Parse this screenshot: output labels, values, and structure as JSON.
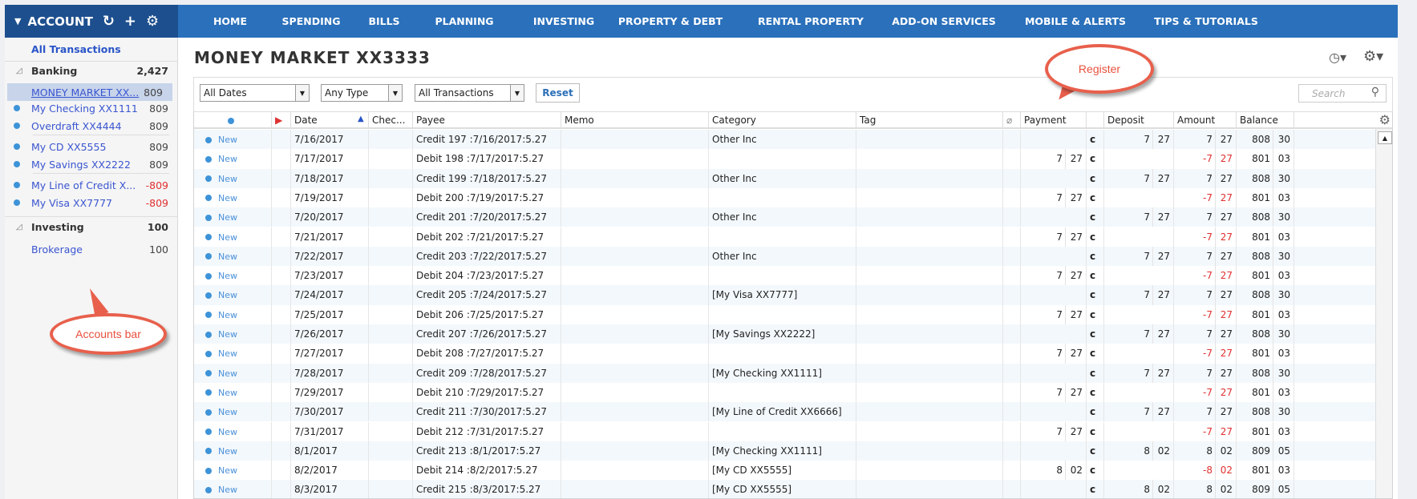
{
  "header": {
    "accounts_label": "ACCOUNT",
    "icons": [
      "caret-down-icon",
      "refresh-icon",
      "plus-icon",
      "gear-icon"
    ]
  },
  "nav": [
    "HOME",
    "SPENDING",
    "BILLS",
    "PLANNING",
    "INVESTING",
    "PROPERTY & DEBT",
    "RENTAL PROPERTY",
    "ADD-ON SERVICES",
    "MOBILE & ALERTS",
    "TIPS & TUTORIALS"
  ],
  "sidebar": {
    "all_transactions": "All Transactions",
    "banking": {
      "label": "Banking",
      "count": "2,427"
    },
    "accounts": [
      {
        "label": "MONEY MARKET XX...",
        "count": "809",
        "selected": true
      },
      {
        "label": "My Checking XX1111",
        "count": "809"
      },
      {
        "label": "Overdraft XX4444",
        "count": "809"
      },
      {
        "label": "My CD XX5555",
        "count": "809"
      },
      {
        "label": "My Savings XX2222",
        "count": "809"
      },
      {
        "label": "My Line of Credit X...",
        "count": "-809"
      },
      {
        "label": "My Visa XX7777",
        "count": "-809"
      }
    ],
    "investing": {
      "label": "Investing",
      "count": "100"
    },
    "brokerage": {
      "label": "Brokerage",
      "count": "100"
    }
  },
  "register": {
    "title": "MONEY MARKET XX3333",
    "filters": {
      "dates": "All Dates",
      "type": "Any Type",
      "transactions": "All Transactions",
      "reset": "Reset",
      "search_placeholder": "Search"
    },
    "columns": [
      "Date",
      "Chec...",
      "Payee",
      "Memo",
      "Category",
      "Tag",
      "Payment",
      "Deposit",
      "Amount",
      "Balance"
    ],
    "status_label": "New",
    "rows": [
      {
        "date": "7/16/2017",
        "payee": "Credit 197 :7/16/2017:5.27",
        "category": "Other Inc",
        "payment": null,
        "deposit": [
          "7",
          "27"
        ],
        "amount": [
          "7",
          "27"
        ],
        "balance": [
          "808",
          "30"
        ]
      },
      {
        "date": "7/17/2017",
        "payee": "Debit 198 :7/17/2017:5.27",
        "category": "",
        "payment": [
          "7",
          "27"
        ],
        "deposit": null,
        "amount": [
          "-7",
          "27"
        ],
        "balance": [
          "801",
          "03"
        ]
      },
      {
        "date": "7/18/2017",
        "payee": "Credit 199 :7/18/2017:5.27",
        "category": "Other Inc",
        "payment": null,
        "deposit": [
          "7",
          "27"
        ],
        "amount": [
          "7",
          "27"
        ],
        "balance": [
          "808",
          "30"
        ]
      },
      {
        "date": "7/19/2017",
        "payee": "Debit 200 :7/19/2017:5.27",
        "category": "",
        "payment": [
          "7",
          "27"
        ],
        "deposit": null,
        "amount": [
          "-7",
          "27"
        ],
        "balance": [
          "801",
          "03"
        ]
      },
      {
        "date": "7/20/2017",
        "payee": "Credit 201 :7/20/2017:5.27",
        "category": "Other Inc",
        "payment": null,
        "deposit": [
          "7",
          "27"
        ],
        "amount": [
          "7",
          "27"
        ],
        "balance": [
          "808",
          "30"
        ]
      },
      {
        "date": "7/21/2017",
        "payee": "Debit 202 :7/21/2017:5.27",
        "category": "",
        "payment": [
          "7",
          "27"
        ],
        "deposit": null,
        "amount": [
          "-7",
          "27"
        ],
        "balance": [
          "801",
          "03"
        ]
      },
      {
        "date": "7/22/2017",
        "payee": "Credit 203 :7/22/2017:5.27",
        "category": "Other Inc",
        "payment": null,
        "deposit": [
          "7",
          "27"
        ],
        "amount": [
          "7",
          "27"
        ],
        "balance": [
          "808",
          "30"
        ]
      },
      {
        "date": "7/23/2017",
        "payee": "Debit 204 :7/23/2017:5.27",
        "category": "",
        "payment": [
          "7",
          "27"
        ],
        "deposit": null,
        "amount": [
          "-7",
          "27"
        ],
        "balance": [
          "801",
          "03"
        ]
      },
      {
        "date": "7/24/2017",
        "payee": "Credit 205 :7/24/2017:5.27",
        "category": "[My Visa XX7777]",
        "payment": null,
        "deposit": [
          "7",
          "27"
        ],
        "amount": [
          "7",
          "27"
        ],
        "balance": [
          "808",
          "30"
        ]
      },
      {
        "date": "7/25/2017",
        "payee": "Debit 206 :7/25/2017:5.27",
        "category": "",
        "payment": [
          "7",
          "27"
        ],
        "deposit": null,
        "amount": [
          "-7",
          "27"
        ],
        "balance": [
          "801",
          "03"
        ]
      },
      {
        "date": "7/26/2017",
        "payee": "Credit 207 :7/26/2017:5.27",
        "category": "[My Savings XX2222]",
        "payment": null,
        "deposit": [
          "7",
          "27"
        ],
        "amount": [
          "7",
          "27"
        ],
        "balance": [
          "808",
          "30"
        ]
      },
      {
        "date": "7/27/2017",
        "payee": "Debit 208 :7/27/2017:5.27",
        "category": "",
        "payment": [
          "7",
          "27"
        ],
        "deposit": null,
        "amount": [
          "-7",
          "27"
        ],
        "balance": [
          "801",
          "03"
        ]
      },
      {
        "date": "7/28/2017",
        "payee": "Credit 209 :7/28/2017:5.27",
        "category": "[My Checking XX1111]",
        "payment": null,
        "deposit": [
          "7",
          "27"
        ],
        "amount": [
          "7",
          "27"
        ],
        "balance": [
          "808",
          "30"
        ]
      },
      {
        "date": "7/29/2017",
        "payee": "Debit 210 :7/29/2017:5.27",
        "category": "",
        "payment": [
          "7",
          "27"
        ],
        "deposit": null,
        "amount": [
          "-7",
          "27"
        ],
        "balance": [
          "801",
          "03"
        ]
      },
      {
        "date": "7/30/2017",
        "payee": "Credit 211 :7/30/2017:5.27",
        "category": "[My Line of Credit XX6666]",
        "payment": null,
        "deposit": [
          "7",
          "27"
        ],
        "amount": [
          "7",
          "27"
        ],
        "balance": [
          "808",
          "30"
        ]
      },
      {
        "date": "7/31/2017",
        "payee": "Debit 212 :7/31/2017:5.27",
        "category": "",
        "payment": [
          "7",
          "27"
        ],
        "deposit": null,
        "amount": [
          "-7",
          "27"
        ],
        "balance": [
          "801",
          "03"
        ]
      },
      {
        "date": "8/1/2017",
        "payee": "Credit 213 :8/1/2017:5.27",
        "category": "[My Checking XX1111]",
        "payment": null,
        "deposit": [
          "8",
          "02"
        ],
        "amount": [
          "8",
          "02"
        ],
        "balance": [
          "809",
          "05"
        ]
      },
      {
        "date": "8/2/2017",
        "payee": "Debit 214 :8/2/2017:5.27",
        "category": "[My CD XX5555]",
        "payment": [
          "8",
          "02"
        ],
        "deposit": null,
        "amount": [
          "-8",
          "02"
        ],
        "balance": [
          "801",
          "03"
        ]
      },
      {
        "date": "8/3/2017",
        "payee": "Credit 215 :8/3/2017:5.27",
        "category": "[My CD XX5555]",
        "payment": null,
        "deposit": [
          "8",
          "02"
        ],
        "amount": [
          "8",
          "02"
        ],
        "balance": [
          "809",
          "05"
        ]
      }
    ],
    "cleared_mark": "c"
  },
  "callouts": {
    "register": "Register",
    "accounts_bar": "Accounts bar"
  },
  "colors": {
    "nav": "#2a70bb",
    "accounts_header": "#1d4f8e",
    "negative": "#e03030",
    "callout": "#e8604c"
  }
}
